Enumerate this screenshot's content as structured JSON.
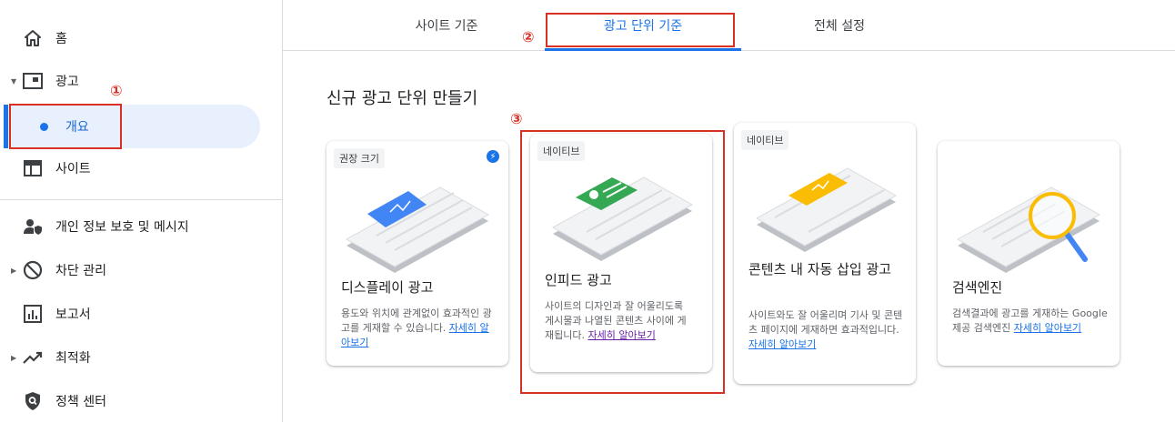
{
  "sidebar": {
    "items": [
      {
        "label": "홈",
        "icon": "home-icon"
      },
      {
        "label": "광고",
        "icon": "ads-icon"
      },
      {
        "label": "개요",
        "icon": "dot-icon"
      },
      {
        "label": "사이트",
        "icon": "sites-icon"
      },
      {
        "label": "개인 정보 보호 및 메시지",
        "icon": "privacy-icon"
      },
      {
        "label": "차단 관리",
        "icon": "block-icon"
      },
      {
        "label": "보고서",
        "icon": "reports-icon"
      },
      {
        "label": "최적화",
        "icon": "optimize-icon"
      },
      {
        "label": "정책 센터",
        "icon": "policy-icon"
      }
    ]
  },
  "tabs": [
    {
      "label": "사이트 기준"
    },
    {
      "label": "광고 단위 기준"
    },
    {
      "label": "전체 설정"
    }
  ],
  "main": {
    "title": "신규 광고 단위 만들기",
    "cards": [
      {
        "chip": "권장 크기",
        "title": "디스플레이 광고",
        "desc": "용도와 위치에 관계없이 효과적인 광고를 게재할 수 있습니다.",
        "link": "자세히 알아보기"
      },
      {
        "chip": "네이티브",
        "title": "인피드 광고",
        "desc": "사이트의 디자인과 잘 어울리도록 게시물과 나열된 콘텐츠 사이에 게재됩니다.",
        "link": "자세히 알아보기"
      },
      {
        "chip": "네이티브",
        "title": "콘텐츠 내 자동 삽입 광고",
        "desc": "사이트와도 잘 어울리며 기사 및 콘텐츠 페이지에 게재하면 효과적입니다.",
        "link": "자세히 알아보기"
      },
      {
        "chip": "",
        "title": "검색엔진",
        "desc": "검색결과에 광고를 게재하는 Google 제공 검색엔진",
        "link": "자세히 알아보기"
      }
    ]
  },
  "annotations": [
    "①",
    "②",
    "③"
  ],
  "colors": {
    "accent": "#1a73e8",
    "annotation": "#d93025",
    "selected_bg": "#e8f0fe"
  }
}
